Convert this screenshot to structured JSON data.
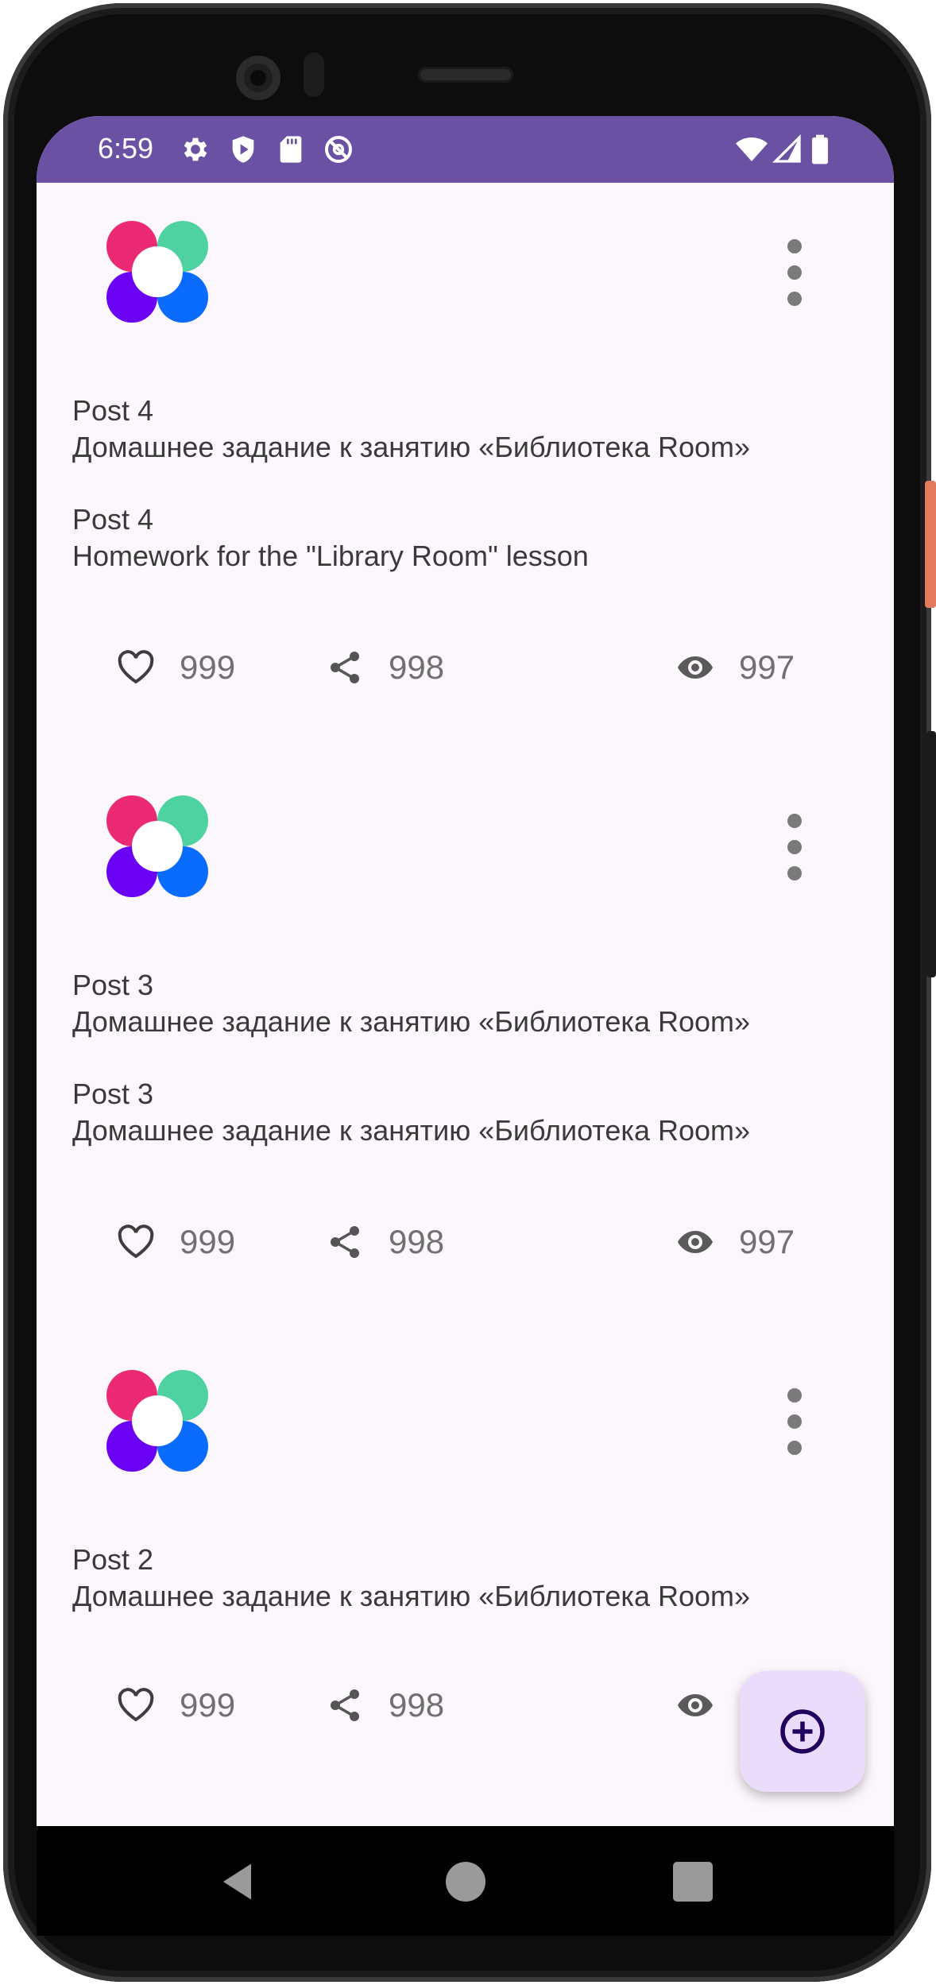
{
  "status_bar": {
    "time": "6:59",
    "left_icons": [
      "gear-icon",
      "shield-icon",
      "sd-card-icon",
      "no-sync-icon"
    ],
    "right_icons": [
      "wifi-icon",
      "cellular-signal-icon",
      "battery-icon"
    ]
  },
  "posts": [
    {
      "avatar": "app-logo-icon",
      "lines": [
        "Post 4",
        "Домашнее задание к занятию «Библиотека Room»",
        "Post 4",
        "Homework for the \"Library Room\" lesson"
      ],
      "likes": "999",
      "shares": "998",
      "views": "997"
    },
    {
      "avatar": "app-logo-icon",
      "lines": [
        "Post 3",
        "Домашнее задание к занятию «Библиотека Room»",
        "Post 3",
        "Домашнее задание к занятию «Библиотека Room»"
      ],
      "likes": "999",
      "shares": "998",
      "views": "997"
    },
    {
      "avatar": "app-logo-icon",
      "lines": [
        "Post 2",
        "Домашнее задание к занятию «Библиотека Room»"
      ],
      "likes": "999",
      "shares": "998",
      "views": ""
    }
  ],
  "fab": {
    "icon": "add-circle-icon"
  },
  "navigation": {
    "icons": [
      "back-icon",
      "home-icon",
      "recents-icon"
    ]
  },
  "colors": {
    "status_bar": "#6b51a4",
    "background": "#fcf7fc",
    "fab": "#e9ddfb",
    "logo_pink": "#ec2a74",
    "logo_green": "#4fd2a1",
    "logo_purple": "#6a00f4",
    "logo_blue": "#0a6cff"
  }
}
